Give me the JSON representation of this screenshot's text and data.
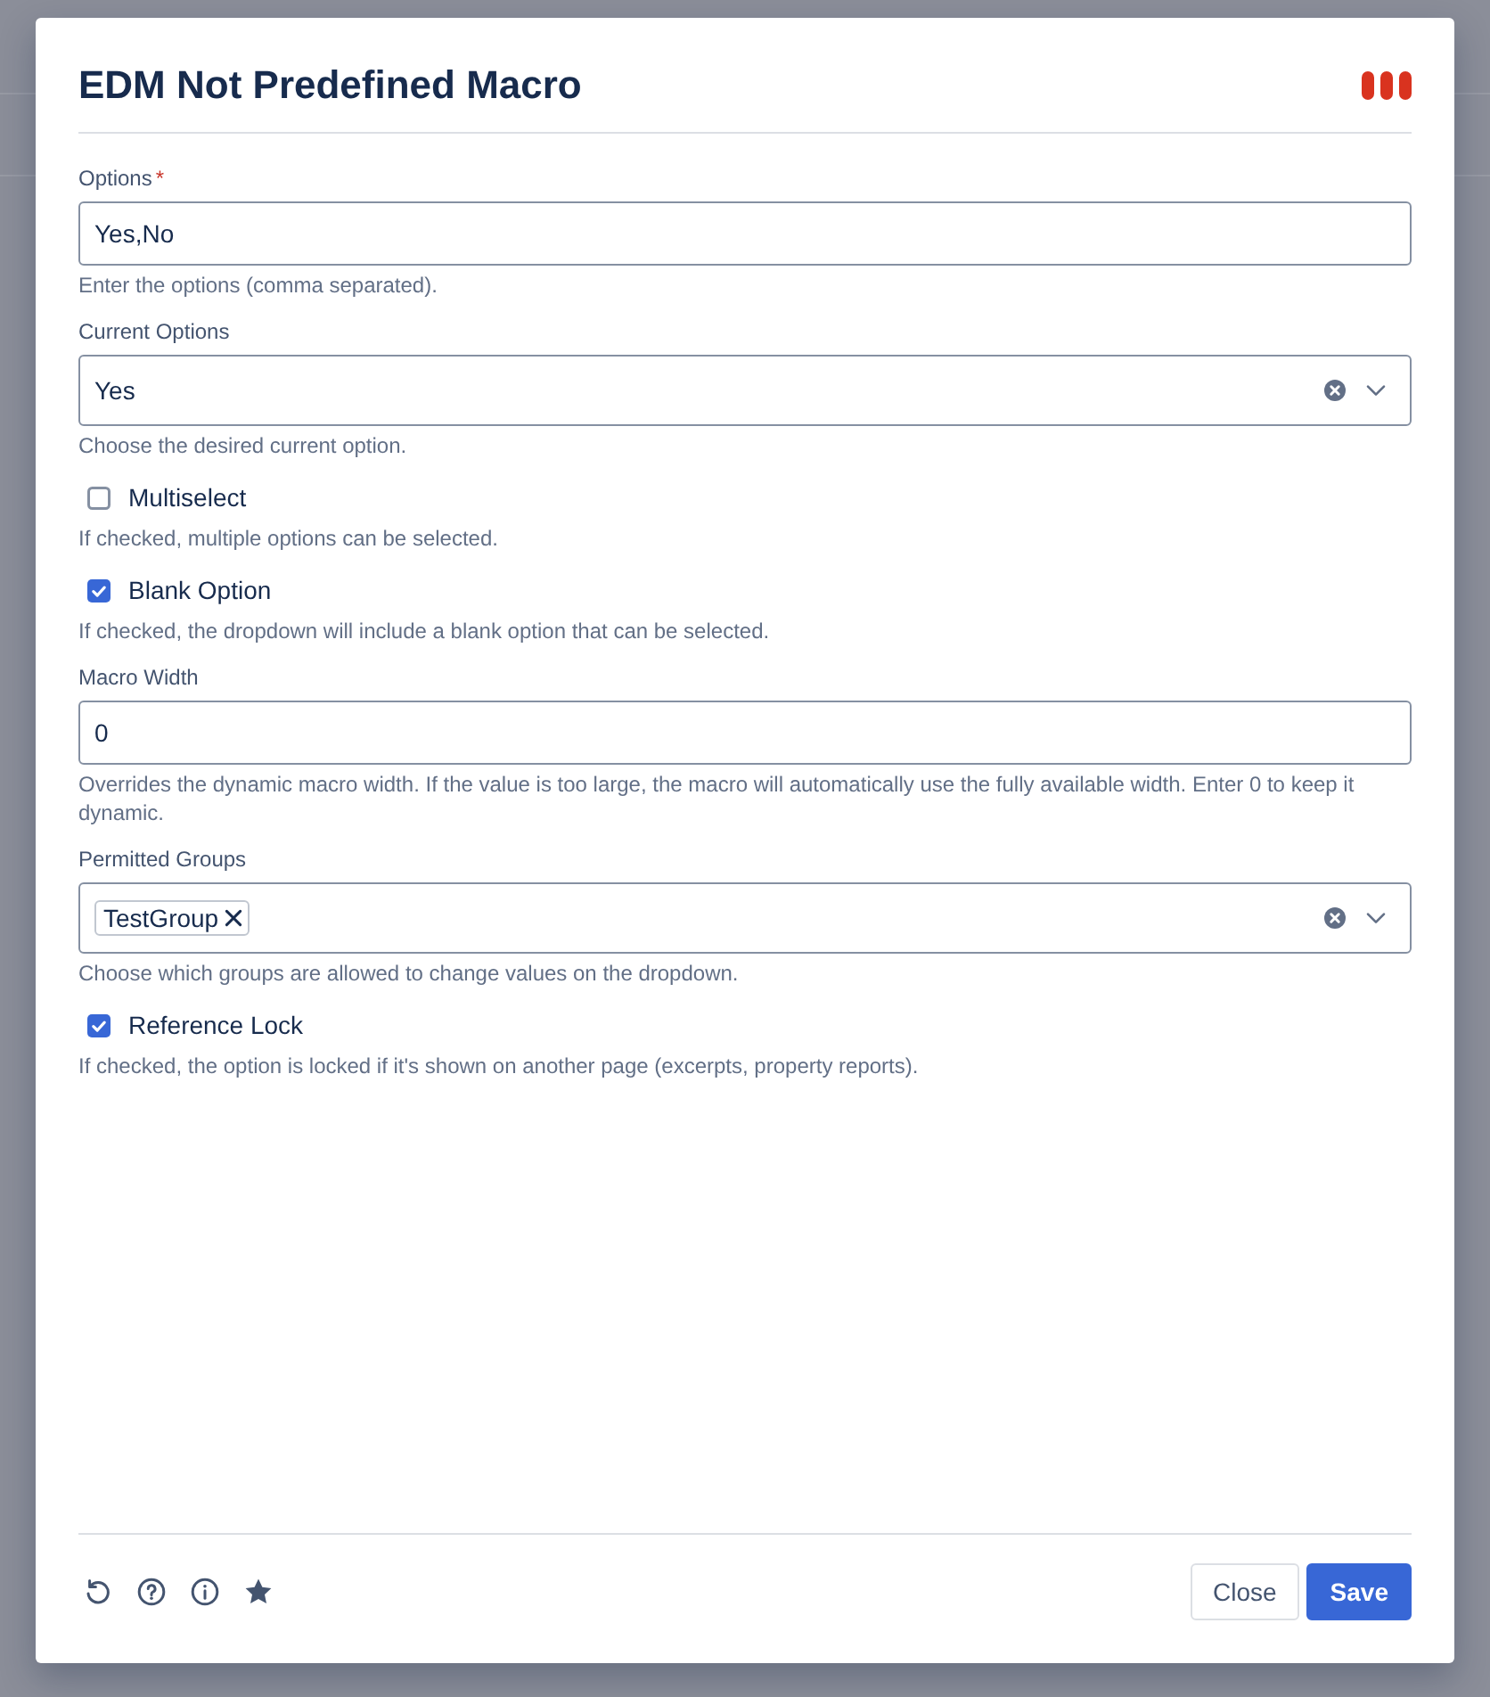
{
  "dialog": {
    "title": "EDM Not Predefined Macro"
  },
  "fields": [
    {
      "kind": "text",
      "label": "Options",
      "required_mark": "*",
      "value": "Yes,No",
      "help": "Enter the options (comma separated)."
    },
    {
      "kind": "select",
      "label": "Current Options",
      "value": "Yes",
      "help": "Choose the desired current option."
    },
    {
      "kind": "checkbox",
      "label": "Multiselect",
      "checked": false,
      "help": "If checked, multiple options can be selected."
    },
    {
      "kind": "checkbox",
      "label": "Blank Option",
      "checked": true,
      "help": "If checked, the dropdown will include a blank option that can be selected."
    },
    {
      "kind": "text",
      "label": "Macro Width",
      "value": "0",
      "help": "Overrides the dynamic macro width. If the value is too large, the macro will automatically use the fully available width. Enter 0 to keep it dynamic."
    },
    {
      "kind": "multiselect",
      "label": "Permitted Groups",
      "tags": [
        "TestGroup"
      ],
      "help": "Choose which groups are allowed to change values on the dropdown."
    },
    {
      "kind": "checkbox",
      "label": "Reference Lock",
      "checked": true,
      "help": "If checked, the option is locked if it's shown on another page (excerpts, property reports)."
    }
  ],
  "footer": {
    "buttons": [
      {
        "label": "Close",
        "kind": "secondary"
      },
      {
        "label": "Save",
        "kind": "primary"
      }
    ]
  }
}
